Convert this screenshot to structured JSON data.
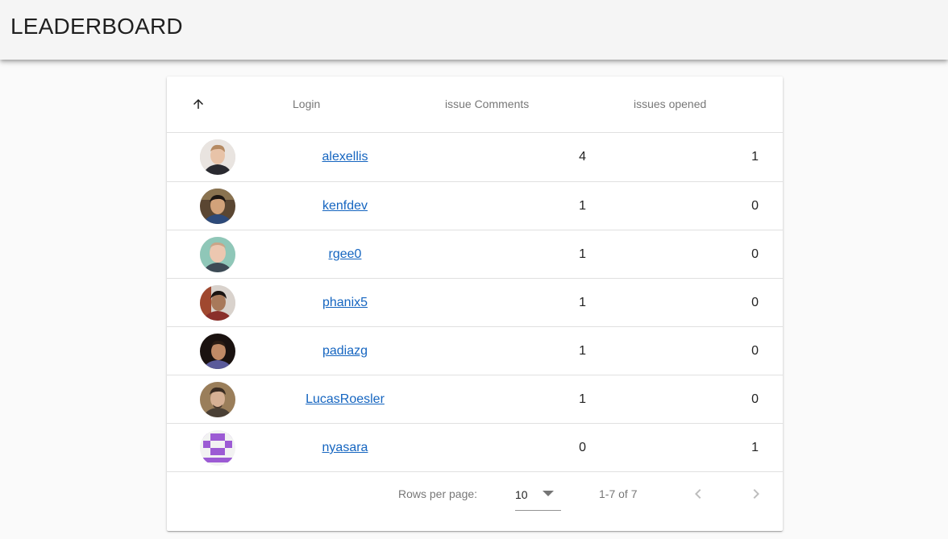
{
  "header": {
    "title": "LEADERBOARD"
  },
  "table": {
    "columns": {
      "sort_icon": "arrow-upward-icon",
      "login": "Login",
      "comments": "issue Comments",
      "opened": "issues opened"
    },
    "rows": [
      {
        "login": "alexellis",
        "comments": "4",
        "opened": "1",
        "avatar": "avatar-photo"
      },
      {
        "login": "kenfdev",
        "comments": "1",
        "opened": "0",
        "avatar": "avatar-photo"
      },
      {
        "login": "rgee0",
        "comments": "1",
        "opened": "0",
        "avatar": "avatar-photo"
      },
      {
        "login": "phanix5",
        "comments": "1",
        "opened": "0",
        "avatar": "avatar-photo"
      },
      {
        "login": "padiazg",
        "comments": "1",
        "opened": "0",
        "avatar": "avatar-photo"
      },
      {
        "login": "LucasRoesler",
        "comments": "1",
        "opened": "0",
        "avatar": "avatar-photo"
      },
      {
        "login": "nyasara",
        "comments": "0",
        "opened": "1",
        "avatar": "identicon"
      }
    ]
  },
  "pagination": {
    "rows_per_page_label": "Rows per page:",
    "rows_per_page_value": "10",
    "range_text": "1-7 of 7"
  },
  "colors": {
    "link": "#1565c0",
    "identicon": "#9c5bd4"
  }
}
